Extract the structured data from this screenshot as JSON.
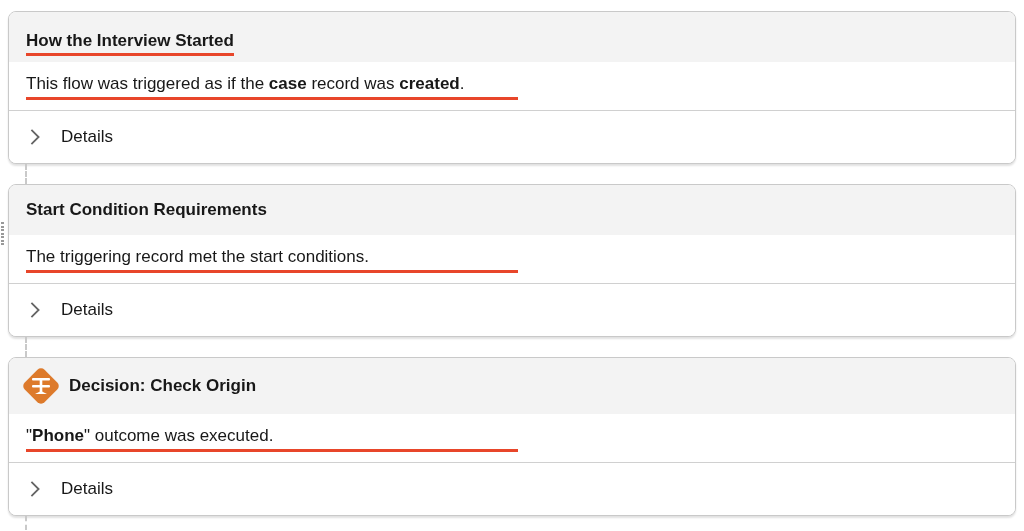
{
  "cards": [
    {
      "kind": "plain",
      "title": "How the Interview Started",
      "title_underlined": true,
      "message": "This flow was triggered as if the **case** record was **created**.",
      "message_underlined": true,
      "details": {
        "label": "Details",
        "expanded": false
      }
    },
    {
      "kind": "plain",
      "title": "Start Condition Requirements",
      "title_underlined": false,
      "message": "The triggering record met the start conditions.",
      "message_underlined": true,
      "details": {
        "label": "Details",
        "expanded": false
      }
    },
    {
      "kind": "decision",
      "title": "Decision: Check Origin",
      "title_underlined": false,
      "message": "\"**Phone**\" outcome was executed.",
      "message_underlined": true,
      "details": {
        "label": "Details",
        "expanded": false
      }
    }
  ]
}
